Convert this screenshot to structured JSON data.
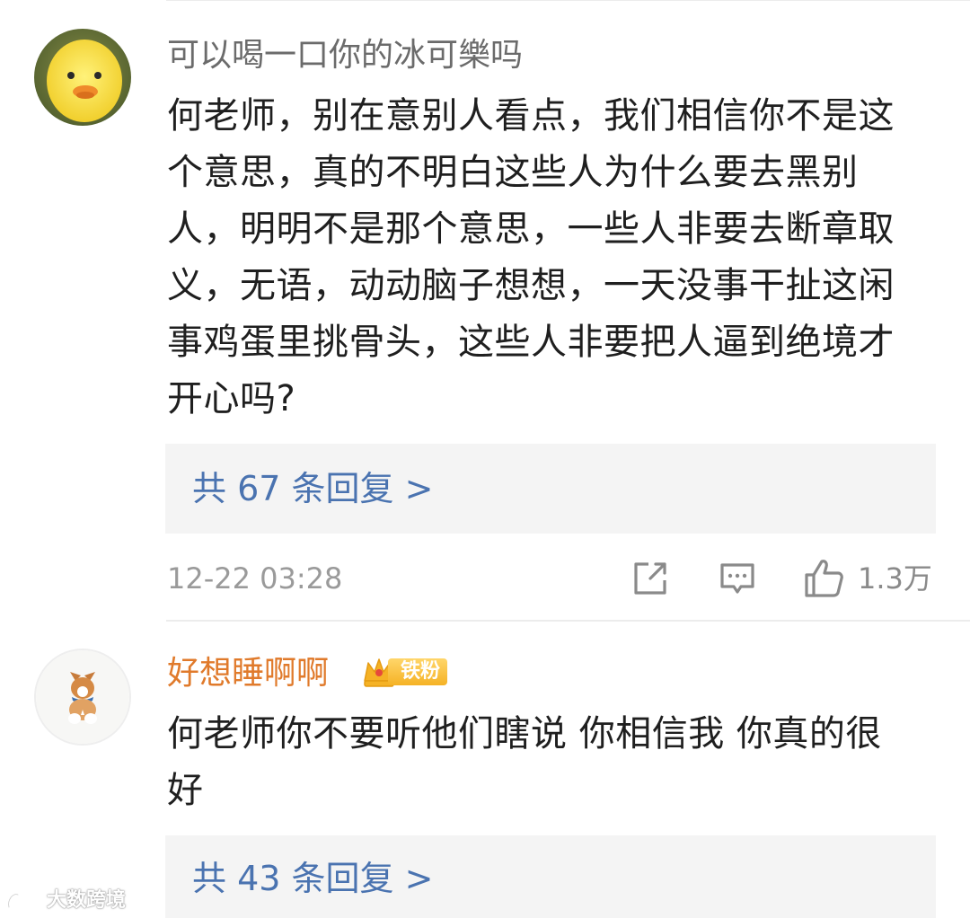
{
  "comments": [
    {
      "username": "可以喝一口你的冰可樂吗",
      "username_color": "#6b6b6b",
      "text": "何老师，别在意别人看点，我们相信你不是这个意思，真的不明白这些人为什么要去黑别人，明明不是那个意思，一些人非要去断章取义，无语，动动脑子想想，一天没事干扯这闲事鸡蛋里挑骨头，这些人非要把人逼到绝境才开心吗?",
      "replies_label": "共 67 条回复 >",
      "time": "12-22 03:28",
      "likes": "1.3万"
    },
    {
      "username": "好想睡啊啊",
      "username_color": "#e07a2b",
      "badge": "铁粉",
      "text": "何老师你不要听他们瞎说 你相信我 你真的很好",
      "replies_label": "共 43 条回复 >"
    }
  ],
  "icons": {
    "share": "share-icon",
    "comment": "comment-icon",
    "like": "thumbs-up-icon",
    "badge": "crown-icon"
  },
  "watermark": {
    "text": "大数跨境"
  },
  "colors": {
    "link": "#4a73b0",
    "meta": "#9a9a9a",
    "box": "#f4f4f4"
  }
}
